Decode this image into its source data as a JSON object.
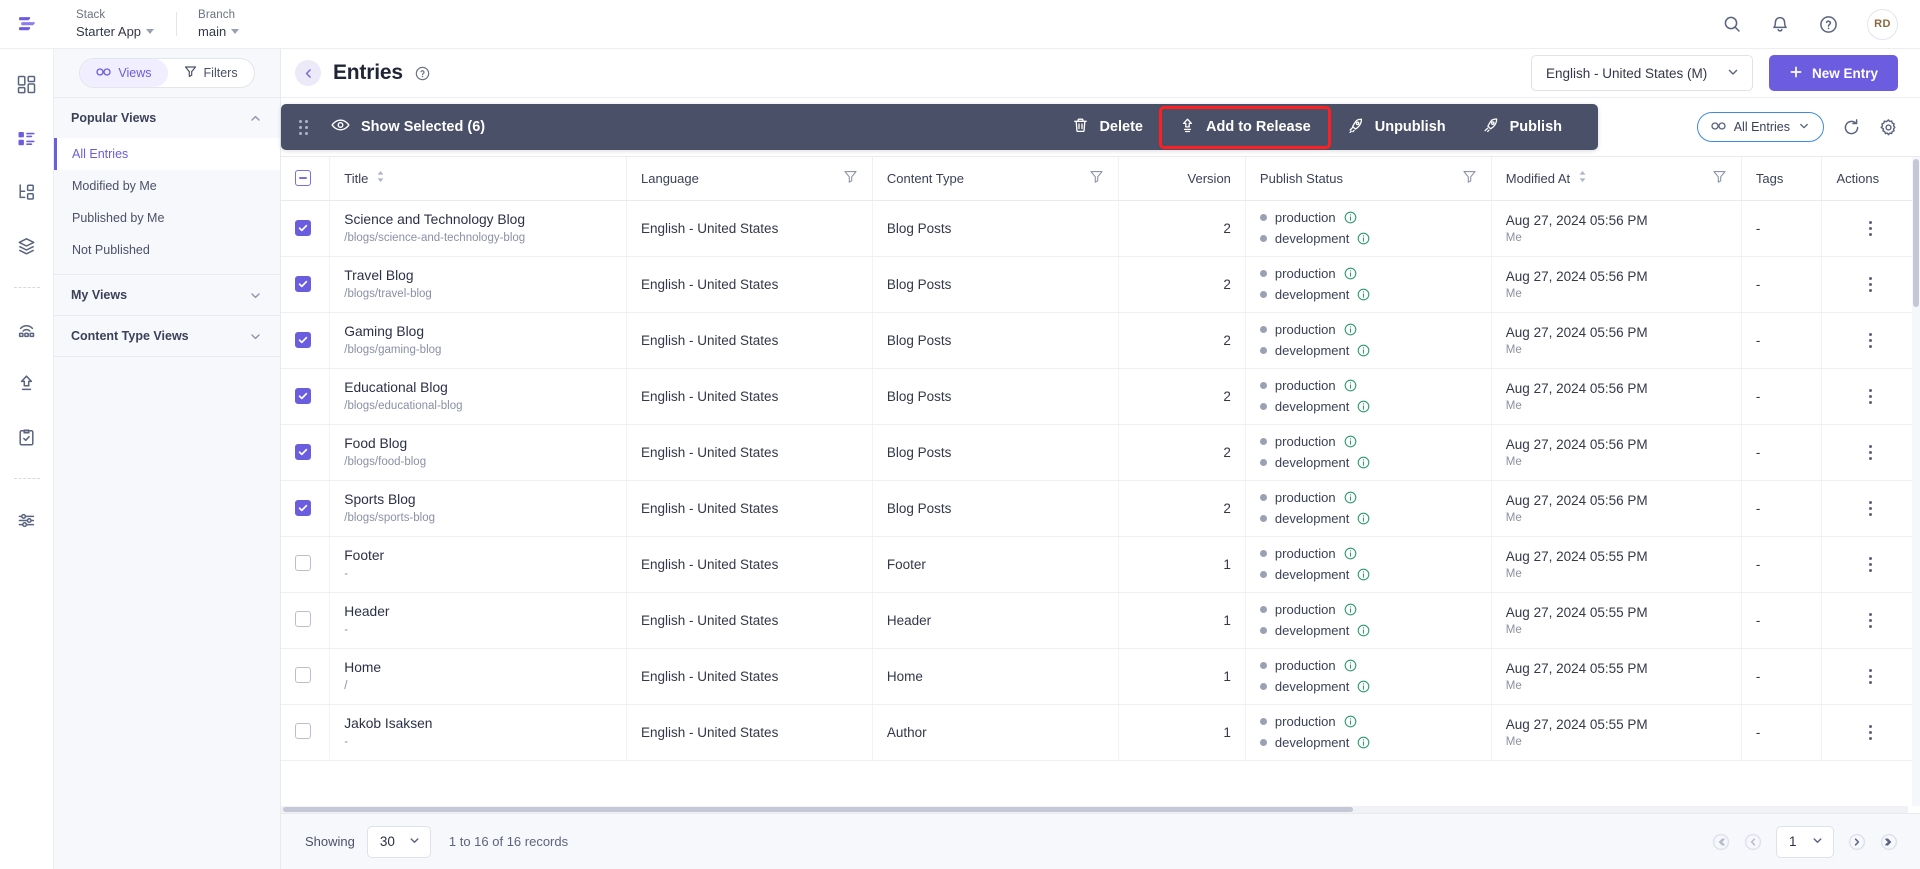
{
  "topbar": {
    "logo_icon": "contentstack-logo",
    "stack": {
      "label": "Stack",
      "value": "Starter App"
    },
    "branch": {
      "label": "Branch",
      "value": "main"
    },
    "search_icon": "search-icon",
    "notifications_icon": "bell-icon",
    "help_icon": "help-circle-icon",
    "avatar_initials": "RD"
  },
  "rail": {
    "items": [
      {
        "name": "dashboard",
        "icon": "dashboard-grid-icon",
        "active": false
      },
      {
        "name": "entries",
        "icon": "entries-list-icon",
        "active": true
      },
      {
        "name": "content-types",
        "icon": "content-type-icon",
        "active": false
      },
      {
        "name": "assets",
        "icon": "layers-icon",
        "active": false
      },
      {
        "name": "live-preview",
        "icon": "broadcast-icon",
        "active": false
      },
      {
        "name": "publish-queue",
        "icon": "upload-arrow-icon",
        "active": false
      },
      {
        "name": "releases",
        "icon": "clipboard-check-icon",
        "active": false
      },
      {
        "name": "settings",
        "icon": "sliders-icon",
        "active": false
      }
    ]
  },
  "views_panel": {
    "toolbar": {
      "views_label": "Views",
      "views_icon": "views-glasses-icon",
      "filters_label": "Filters",
      "filters_icon": "filter-funnel-icon"
    },
    "groups": [
      {
        "label": "Popular Views",
        "expanded": true,
        "chevron": "chevron-up-icon",
        "items": [
          {
            "label": "All Entries",
            "active": true
          },
          {
            "label": "Modified by Me",
            "active": false
          },
          {
            "label": "Published by Me",
            "active": false
          },
          {
            "label": "Not Published",
            "active": false
          }
        ]
      },
      {
        "label": "My Views",
        "expanded": false,
        "chevron": "chevron-down-icon",
        "items": []
      },
      {
        "label": "Content Type Views",
        "expanded": false,
        "chevron": "chevron-down-icon",
        "items": []
      }
    ]
  },
  "main_head": {
    "collapse_icon": "chevron-left-icon",
    "title": "Entries",
    "help_icon": "help-circle-icon",
    "locale": {
      "value": "English - United States (M)",
      "chevron": "chevron-down-icon"
    },
    "new_entry": {
      "label": "New Entry",
      "icon": "plus-icon"
    }
  },
  "bulk_bar": {
    "drag_handle": "drag-dots-icon",
    "show_selected": {
      "label": "Show Selected (6)",
      "icon": "eye-icon"
    },
    "actions": [
      {
        "label": "Delete",
        "icon": "trash-icon",
        "highlighted": false
      },
      {
        "label": "Add to Release",
        "icon": "release-upload-icon",
        "highlighted": true
      },
      {
        "label": "Unpublish",
        "icon": "unpublish-rocket-icon",
        "highlighted": false
      },
      {
        "label": "Publish",
        "icon": "publish-rocket-icon",
        "highlighted": false
      }
    ],
    "highlight_color": "#ff1f1f",
    "background_color": "#4a5068"
  },
  "strip_right": {
    "view_pill": {
      "label": "All Entries",
      "icon": "views-glasses-icon",
      "chevron": "chevron-down-icon"
    },
    "refresh_icon": "refresh-icon",
    "settings_icon": "gear-icon"
  },
  "table": {
    "columns": [
      {
        "key": "check",
        "label": "",
        "filter": false,
        "sort": false
      },
      {
        "key": "title",
        "label": "Title",
        "filter": false,
        "sort": true
      },
      {
        "key": "language",
        "label": "Language",
        "filter": true,
        "sort": false
      },
      {
        "key": "content_type",
        "label": "Content Type",
        "filter": true,
        "sort": false
      },
      {
        "key": "version",
        "label": "Version",
        "filter": false,
        "sort": false
      },
      {
        "key": "publish_status",
        "label": "Publish Status",
        "filter": true,
        "sort": false
      },
      {
        "key": "modified_at",
        "label": "Modified At",
        "filter": true,
        "sort": true
      },
      {
        "key": "tags",
        "label": "Tags",
        "filter": false,
        "sort": false
      },
      {
        "key": "actions",
        "label": "Actions",
        "filter": false,
        "sort": false
      }
    ],
    "header_checkbox_state": "indeterminate",
    "rows": [
      {
        "selected": true,
        "title": "Science and Technology Blog",
        "url": "/blogs/science-and-technology-blog",
        "language": "English - United States",
        "content_type": "Blog Posts",
        "version": "2",
        "publish_status": [
          "production",
          "development"
        ],
        "modified_at": "Aug 27, 2024 05:56 PM",
        "modified_by": "Me",
        "tags": "-"
      },
      {
        "selected": true,
        "title": "Travel Blog",
        "url": "/blogs/travel-blog",
        "language": "English - United States",
        "content_type": "Blog Posts",
        "version": "2",
        "publish_status": [
          "production",
          "development"
        ],
        "modified_at": "Aug 27, 2024 05:56 PM",
        "modified_by": "Me",
        "tags": "-"
      },
      {
        "selected": true,
        "title": "Gaming Blog",
        "url": "/blogs/gaming-blog",
        "language": "English - United States",
        "content_type": "Blog Posts",
        "version": "2",
        "publish_status": [
          "production",
          "development"
        ],
        "modified_at": "Aug 27, 2024 05:56 PM",
        "modified_by": "Me",
        "tags": "-"
      },
      {
        "selected": true,
        "title": "Educational Blog",
        "url": "/blogs/educational-blog",
        "language": "English - United States",
        "content_type": "Blog Posts",
        "version": "2",
        "publish_status": [
          "production",
          "development"
        ],
        "modified_at": "Aug 27, 2024 05:56 PM",
        "modified_by": "Me",
        "tags": "-"
      },
      {
        "selected": true,
        "title": "Food Blog",
        "url": "/blogs/food-blog",
        "language": "English - United States",
        "content_type": "Blog Posts",
        "version": "2",
        "publish_status": [
          "production",
          "development"
        ],
        "modified_at": "Aug 27, 2024 05:56 PM",
        "modified_by": "Me",
        "tags": "-"
      },
      {
        "selected": true,
        "title": "Sports Blog",
        "url": "/blogs/sports-blog",
        "language": "English - United States",
        "content_type": "Blog Posts",
        "version": "2",
        "publish_status": [
          "production",
          "development"
        ],
        "modified_at": "Aug 27, 2024 05:56 PM",
        "modified_by": "Me",
        "tags": "-"
      },
      {
        "selected": false,
        "title": "Footer",
        "url": "-",
        "language": "English - United States",
        "content_type": "Footer",
        "version": "1",
        "publish_status": [
          "production",
          "development"
        ],
        "modified_at": "Aug 27, 2024 05:55 PM",
        "modified_by": "Me",
        "tags": "-"
      },
      {
        "selected": false,
        "title": "Header",
        "url": "-",
        "language": "English - United States",
        "content_type": "Header",
        "version": "1",
        "publish_status": [
          "production",
          "development"
        ],
        "modified_at": "Aug 27, 2024 05:55 PM",
        "modified_by": "Me",
        "tags": "-"
      },
      {
        "selected": false,
        "title": "Home",
        "url": "/",
        "language": "English - United States",
        "content_type": "Home",
        "version": "1",
        "publish_status": [
          "production",
          "development"
        ],
        "modified_at": "Aug 27, 2024 05:55 PM",
        "modified_by": "Me",
        "tags": "-"
      },
      {
        "selected": false,
        "title": "Jakob Isaksen",
        "url": "-",
        "language": "English - United States",
        "content_type": "Author",
        "version": "1",
        "publish_status": [
          "production",
          "development"
        ],
        "modified_at": "Aug 27, 2024 05:55 PM",
        "modified_by": "Me",
        "tags": "-"
      }
    ]
  },
  "footer": {
    "showing_label": "Showing",
    "page_size": "30",
    "records_text": "1 to 16 of 16 records",
    "first_icon": "chevron-double-left-icon",
    "prev_icon": "chevron-left-icon",
    "page_value": "1",
    "next_icon": "chevron-right-icon",
    "last_icon": "chevron-double-right-icon"
  }
}
